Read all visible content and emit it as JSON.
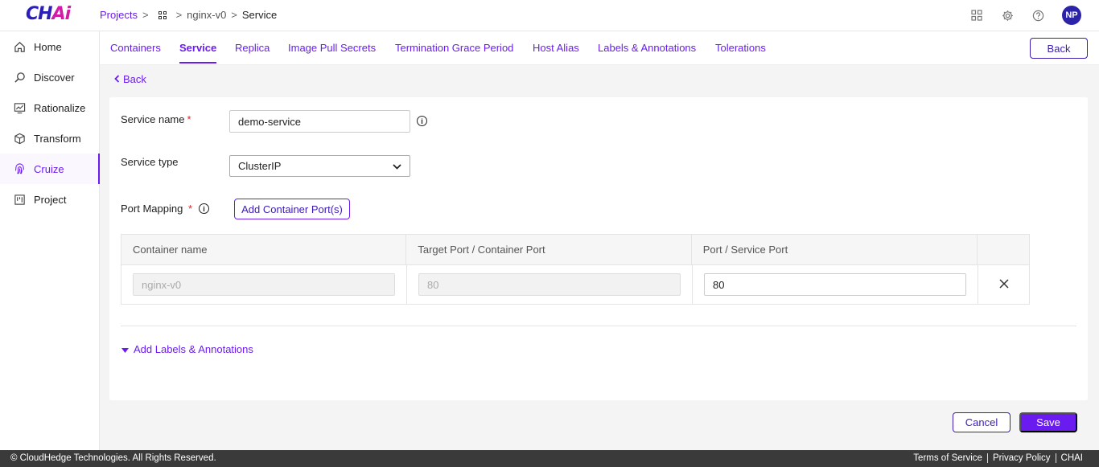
{
  "app": {
    "logo_main": "CH",
    "logo_accent": "Ai",
    "accent_color": "#6a1cf0"
  },
  "breadcrumb": {
    "projects": "Projects",
    "project": "nginx-v0",
    "current": "Service"
  },
  "topbar": {
    "avatar_initials": "NP",
    "icons": [
      "apps-grid-icon",
      "gear-icon",
      "help-icon"
    ]
  },
  "sidebar": {
    "items": [
      {
        "label": "Home",
        "icon": "home-icon"
      },
      {
        "label": "Discover",
        "icon": "search-icon"
      },
      {
        "label": "Rationalize",
        "icon": "chart-icon"
      },
      {
        "label": "Transform",
        "icon": "cube-icon"
      },
      {
        "label": "Cruize",
        "icon": "fingerprint-icon",
        "active": true
      },
      {
        "label": "Project",
        "icon": "board-icon"
      }
    ]
  },
  "tabs": [
    {
      "label": "Containers"
    },
    {
      "label": "Service",
      "active": true
    },
    {
      "label": "Replica"
    },
    {
      "label": "Image Pull Secrets"
    },
    {
      "label": "Termination Grace Period"
    },
    {
      "label": "Host Alias"
    },
    {
      "label": "Labels & Annotations"
    },
    {
      "label": "Tolerations"
    }
  ],
  "back_button_label": "Back",
  "back_link_label": "Back",
  "form": {
    "service_name_label": "Service name",
    "service_name_value": "demo-service",
    "service_type_label": "Service type",
    "service_type_value": "ClusterIP",
    "port_mapping_label": "Port Mapping",
    "add_port_label": "Add Container Port(s)",
    "required_mark": "*",
    "info_mark": "i"
  },
  "port_table": {
    "headers": [
      "Container name",
      "Target Port / Container Port",
      "Port / Service Port"
    ],
    "rows": [
      {
        "container_name": "nginx-v0",
        "target_port": "80",
        "service_port": "80"
      }
    ]
  },
  "add_labels_label": "Add Labels & Annotations",
  "actions": {
    "cancel": "Cancel",
    "save": "Save"
  },
  "footer": {
    "copyright": "© CloudHedge Technologies. All Rights Reserved.",
    "links": [
      "Terms of Service",
      "Privacy Policy",
      "CHAI"
    ]
  }
}
